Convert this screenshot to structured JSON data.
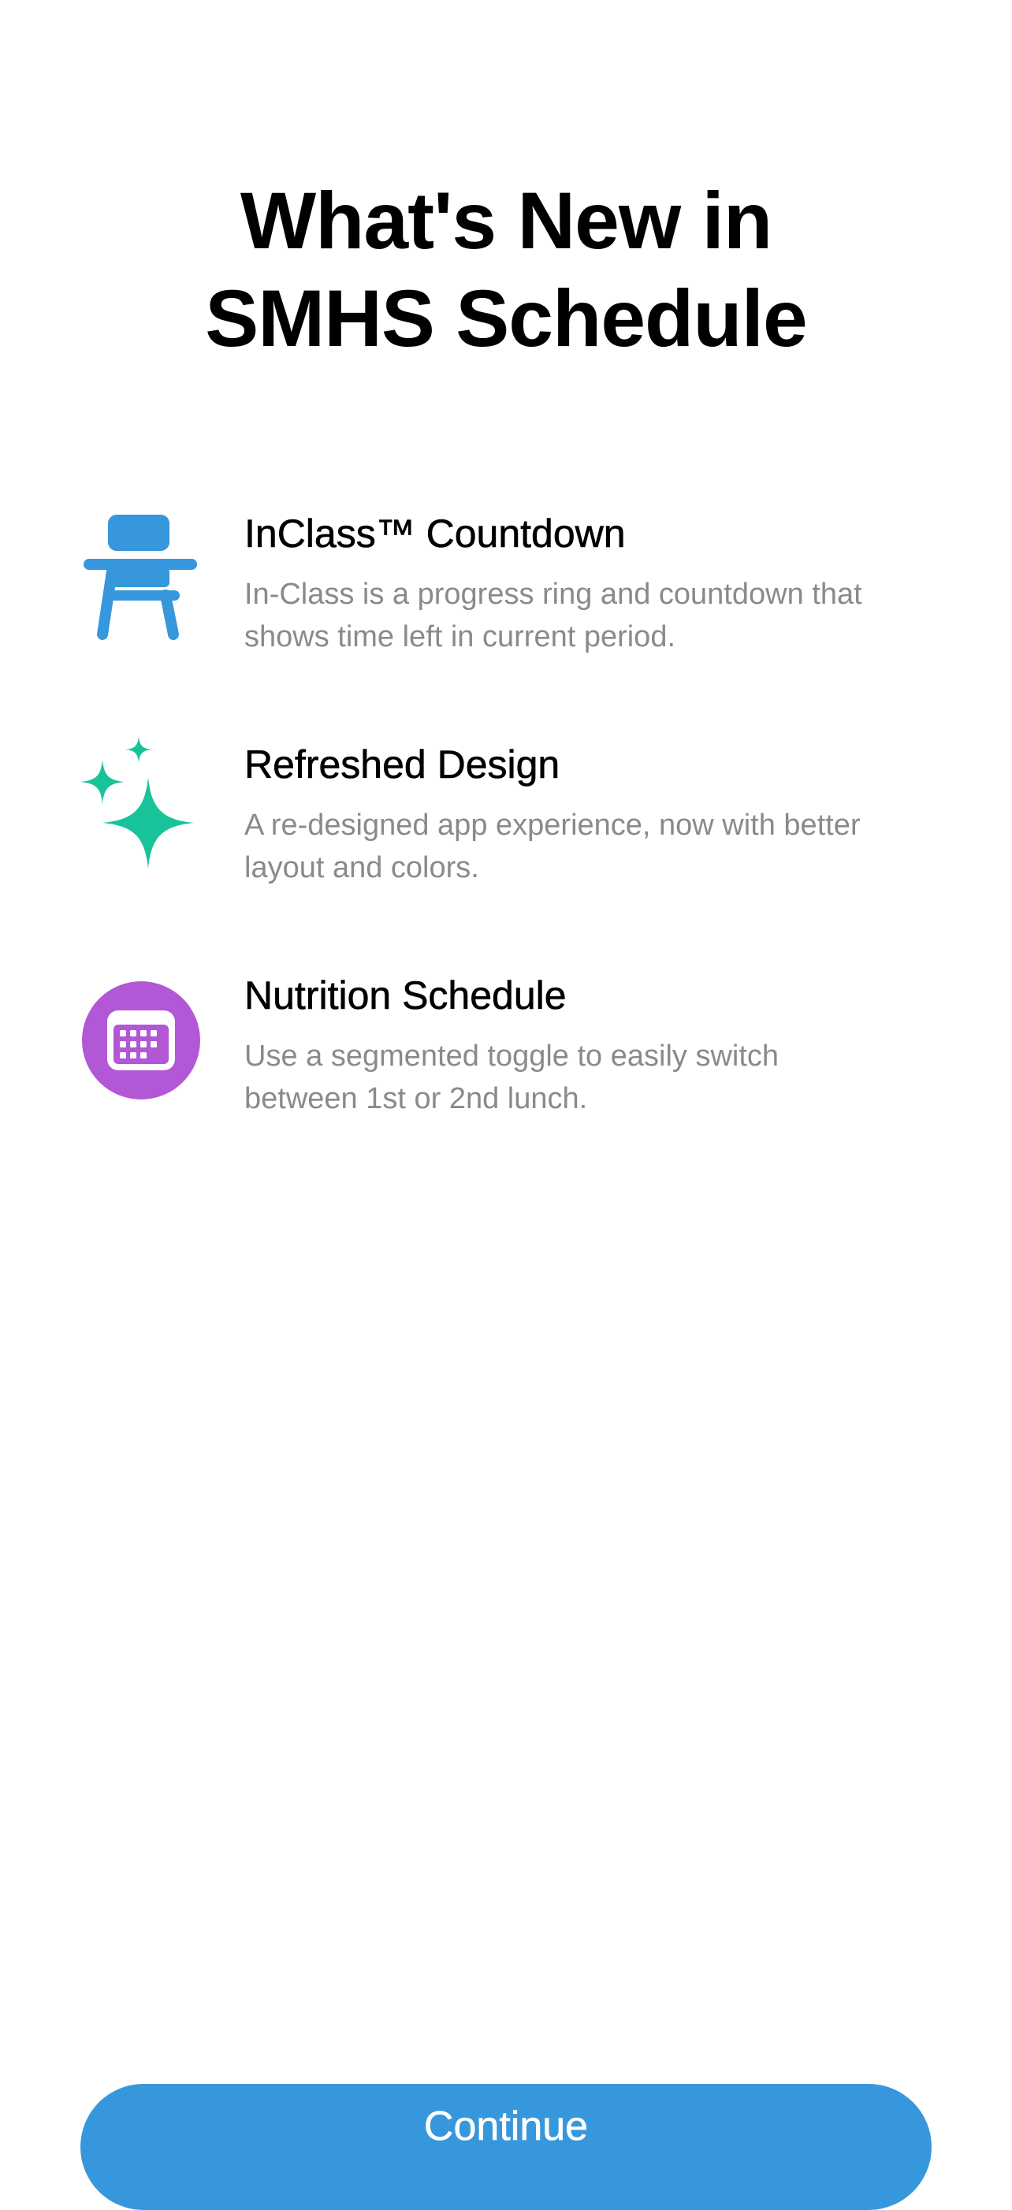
{
  "header": {
    "title_line1": "What's New in",
    "title_line2": "SMHS Schedule"
  },
  "features": [
    {
      "icon": "school-desk-icon",
      "icon_color": "#3797dc",
      "title": "InClass™ Countdown",
      "description_line1": "In-Class is a progress ring and countdown that",
      "description_line2": "shows time left in current period."
    },
    {
      "icon": "sparkles-icon",
      "icon_color": "#19c39a",
      "title": "Refreshed Design",
      "description_line1": "A re-designed app experience, now with better",
      "description_line2": "layout and colors."
    },
    {
      "icon": "calendar-icon",
      "icon_color": "#b257d6",
      "title": "Nutrition Schedule",
      "description_line1": "Use a segmented toggle to easily switch",
      "description_line2": "between 1st or 2nd lunch."
    }
  ],
  "footer": {
    "continue_label": "Continue",
    "button_color": "#3797dc"
  }
}
